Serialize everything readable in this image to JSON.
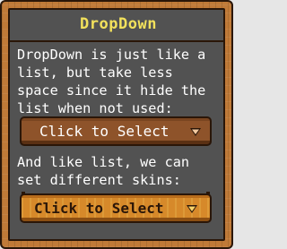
{
  "panel": {
    "title": "DropDown",
    "description": "DropDown is just like a\nlist, but take less\nspace since it hide the\nlist when not used:",
    "skins_text": "And like list, we can\nset different skins:"
  },
  "dropdowns": [
    {
      "selected": "Click to Select",
      "icon": "chevron-down-icon"
    },
    {
      "selected": "Click to Select",
      "icon": "chevron-down-icon"
    }
  ],
  "colors": {
    "title": "#f2e15c",
    "panel_bg": "#525252",
    "frame": "#c07a38",
    "outline": "#2a1608",
    "dropdown_brown": "#8e532a",
    "dropdown_orange": "#d6892a"
  }
}
